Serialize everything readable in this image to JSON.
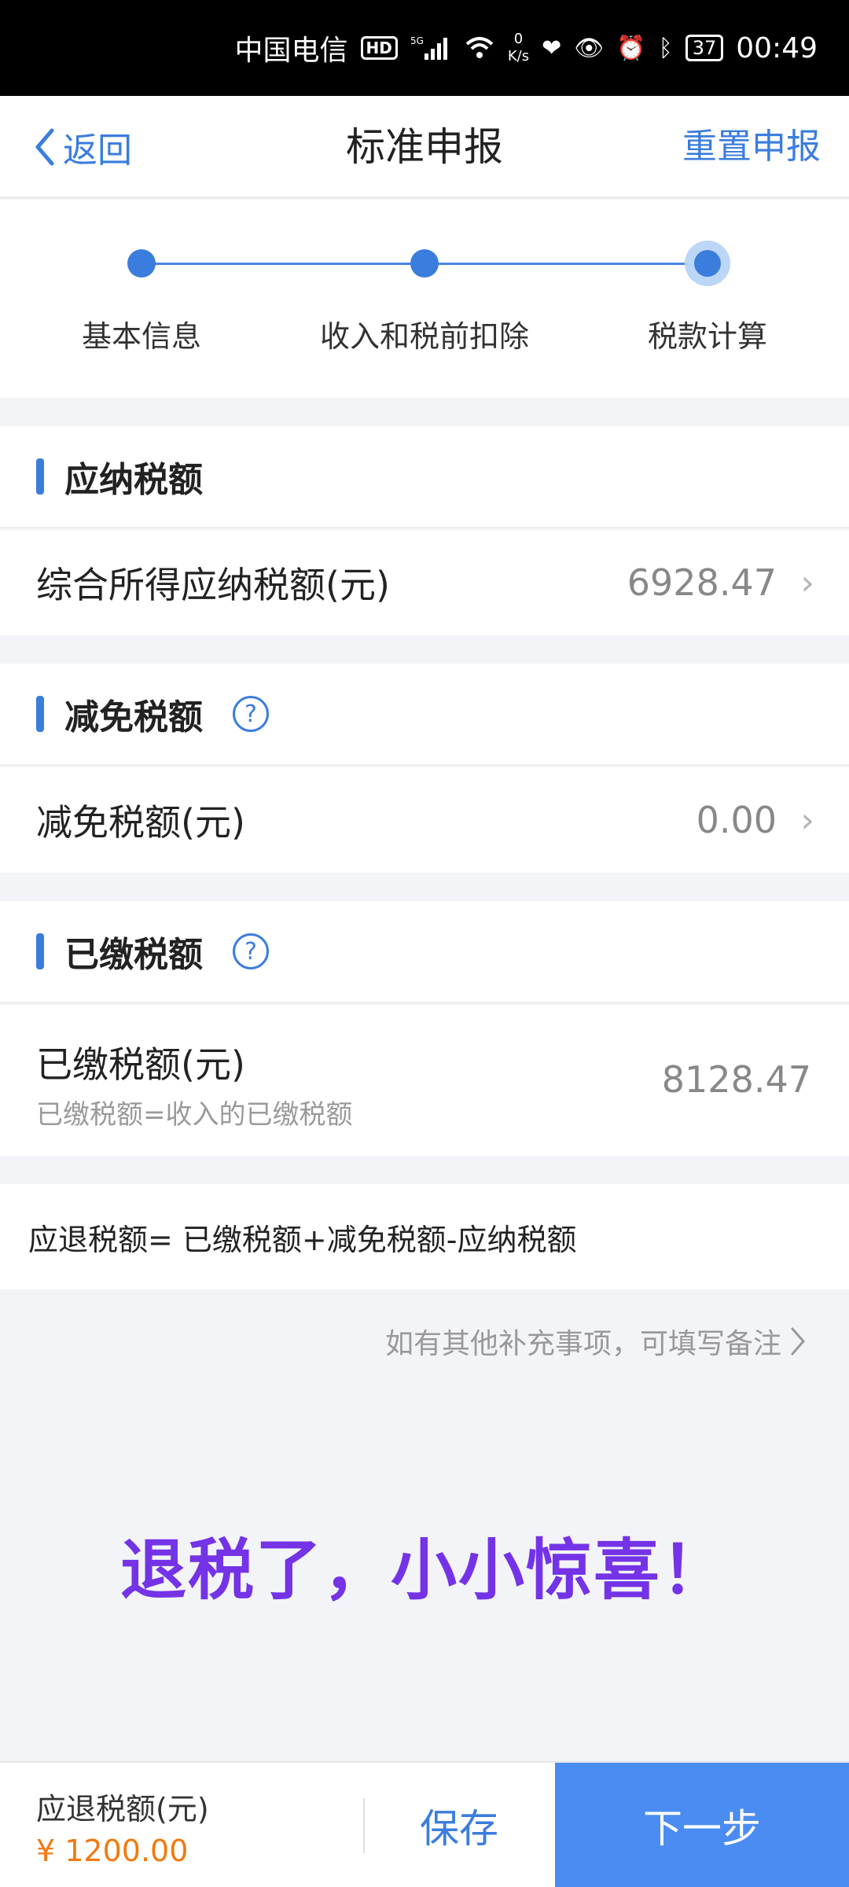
{
  "status_bar": {
    "carrier": "中国电信",
    "hd": "HD",
    "signal": "5G",
    "net_speed_value": "0",
    "net_speed_unit": "K/s",
    "battery": "37",
    "time": "00:49"
  },
  "nav": {
    "back_label": "返回",
    "title": "标准申报",
    "reset_label": "重置申报"
  },
  "steps": [
    {
      "label": "基本信息",
      "state": "done"
    },
    {
      "label": "收入和税前扣除",
      "state": "done"
    },
    {
      "label": "税款计算",
      "state": "active"
    }
  ],
  "sections": {
    "payable": {
      "title": "应纳税额",
      "row_label": "综合所得应纳税额(元)",
      "row_value": "6928.47"
    },
    "reduction": {
      "title": "减免税额",
      "row_label": "减免税额(元)",
      "row_value": "0.00"
    },
    "paid": {
      "title": "已缴税额",
      "row_label": "已缴税额(元)",
      "row_sub": "已缴税额=收入的已缴税额",
      "row_value": "8128.47"
    }
  },
  "formula": "应退税额= 已缴税额+减免税额-应纳税额",
  "note_link": "如有其他补充事项，可填写备注",
  "overlay_caption": "退税了，小小惊喜！",
  "bottom": {
    "refund_label": "应退税额(元)",
    "refund_amount": "¥ 1200.00",
    "save_label": "保存",
    "next_label": "下一步"
  },
  "colors": {
    "accent": "#3b7ddd",
    "next_button": "#4a8cf1",
    "amount": "#f07a10",
    "caption": "#7433e6"
  }
}
